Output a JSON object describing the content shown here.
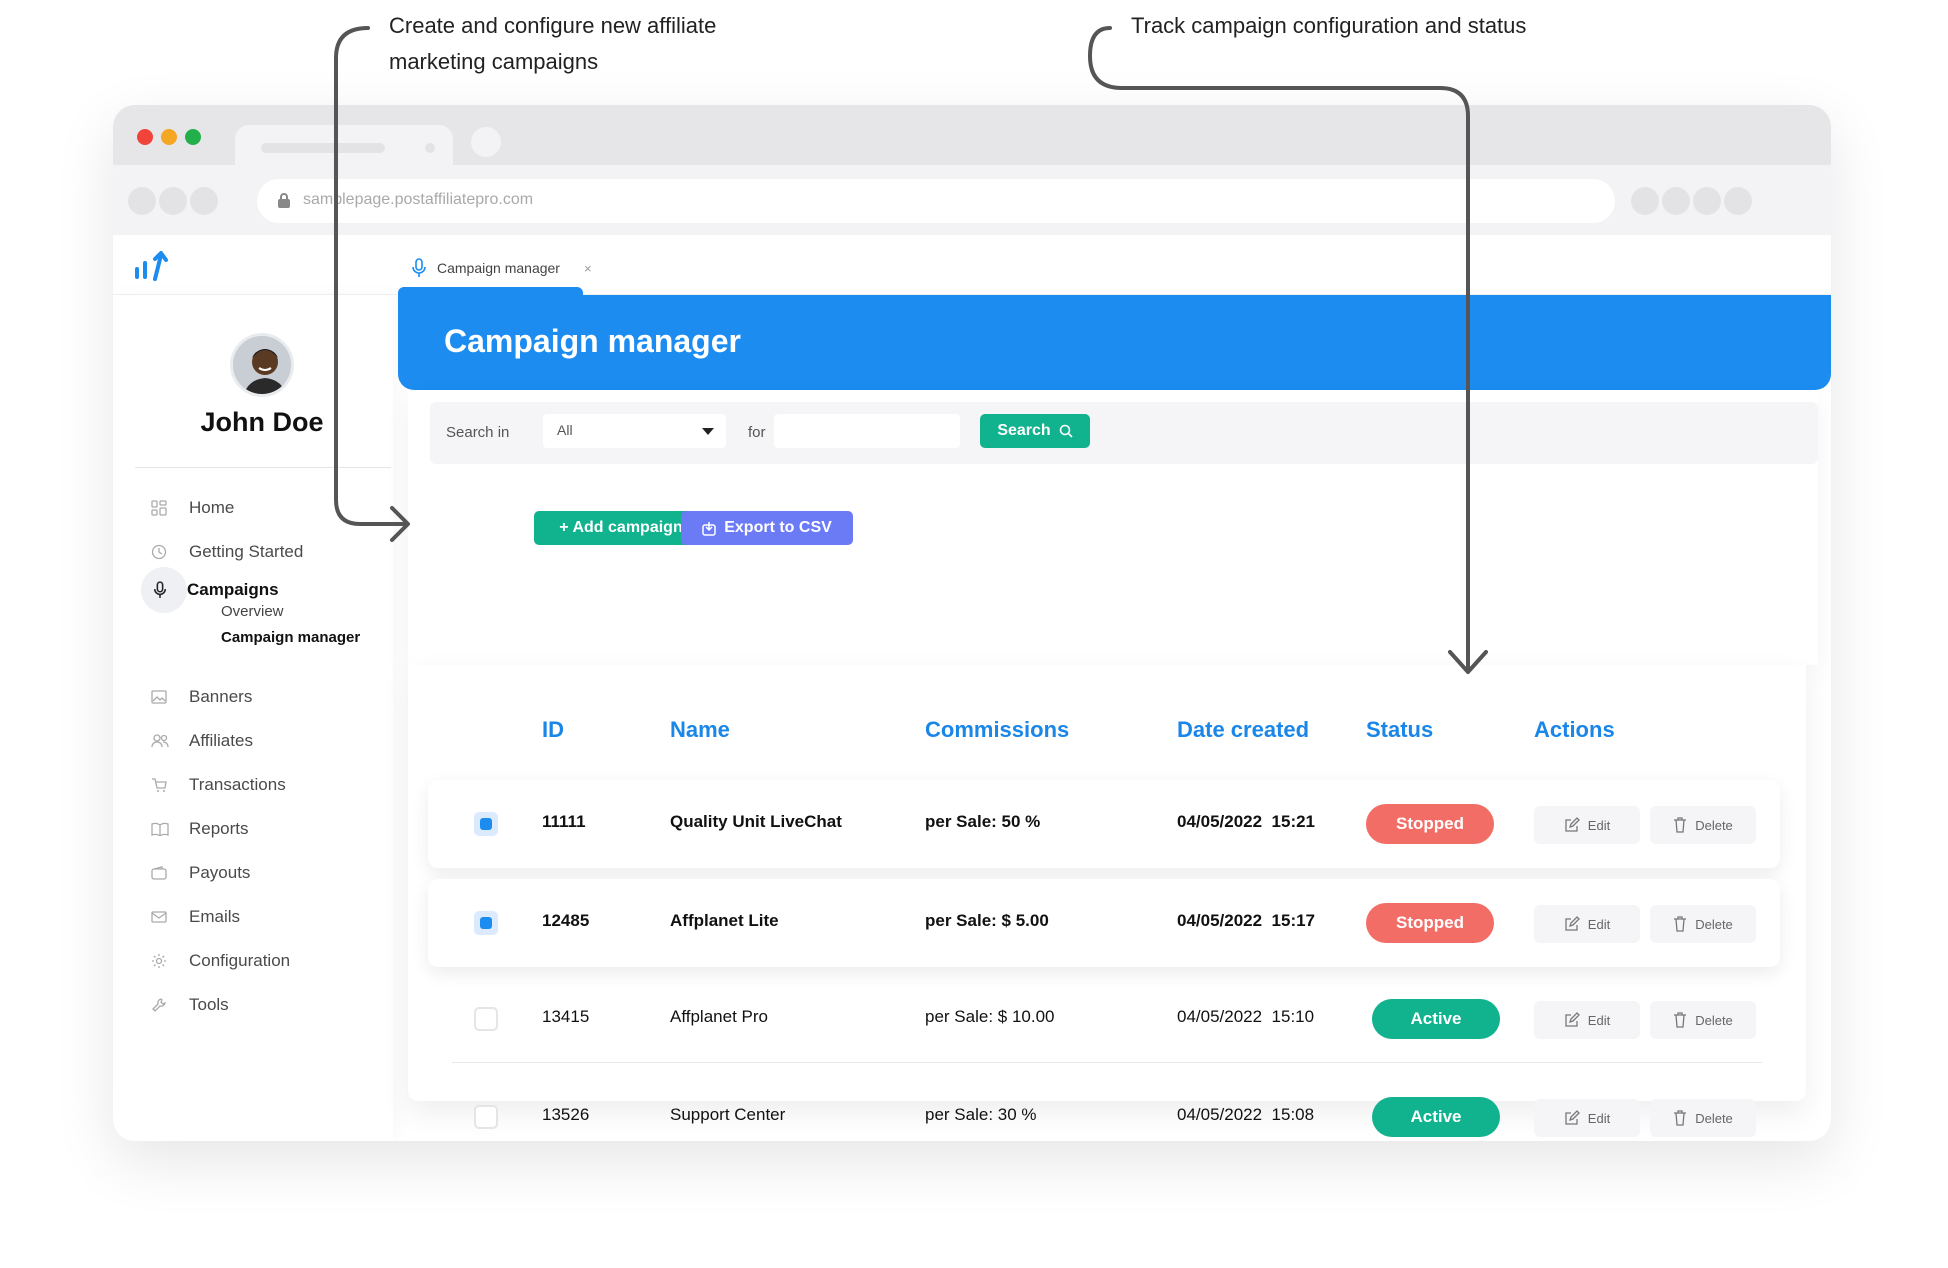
{
  "annotations": {
    "left": "Create and configure new affiliate marketing campaigns",
    "right": "Track campaign configuration and status"
  },
  "browser": {
    "url": "samplepage.postaffiliatepro.com"
  },
  "app": {
    "tab_label": "Campaign manager",
    "tab_close": "×",
    "page_title": "Campaign manager"
  },
  "user": {
    "name": "John Doe"
  },
  "sidebar": {
    "items": [
      {
        "label": "Home",
        "icon": "grid-icon"
      },
      {
        "label": "Getting Started",
        "icon": "clock-icon"
      },
      {
        "label": "Campaigns",
        "icon": "mic-icon"
      },
      {
        "label": "Banners",
        "icon": "image-icon"
      },
      {
        "label": "Affiliates",
        "icon": "users-icon"
      },
      {
        "label": "Transactions",
        "icon": "cart-icon"
      },
      {
        "label": "Reports",
        "icon": "book-icon"
      },
      {
        "label": "Payouts",
        "icon": "wallet-icon"
      },
      {
        "label": "Emails",
        "icon": "mail-icon"
      },
      {
        "label": "Configuration",
        "icon": "gear-icon"
      },
      {
        "label": "Tools",
        "icon": "wrench-icon"
      }
    ],
    "sub_items": [
      "Overview",
      "Campaign manager"
    ]
  },
  "search": {
    "search_in_label": "Search in",
    "select_value": "All",
    "for_label": "for",
    "input_value": "",
    "button_label": "Search"
  },
  "toolbar": {
    "add_label": "+ Add campaign",
    "export_label": "Export to CSV"
  },
  "table": {
    "headers": [
      "ID",
      "Name",
      "Commissions",
      "Date created",
      "Status",
      "Actions"
    ],
    "rows": [
      {
        "id": "11111",
        "name": "Quality Unit LiveChat",
        "commission": "per Sale: 50 %",
        "date": "04/05/2022  15:21",
        "status": "Stopped",
        "checked": true
      },
      {
        "id": "12485",
        "name": "Affplanet Lite",
        "commission": "per Sale: $ 5.00",
        "date": "04/05/2022  15:17",
        "status": "Stopped",
        "checked": true
      },
      {
        "id": "13415",
        "name": "Affplanet Pro",
        "commission": "per Sale: $ 10.00",
        "date": "04/05/2022  15:10",
        "status": "Active",
        "checked": false
      },
      {
        "id": "13526",
        "name": "Support Center",
        "commission": "per Sale: 30 %",
        "date": "04/05/2022  15:08",
        "status": "Active",
        "checked": false
      }
    ],
    "edit_label": "Edit",
    "delete_label": "Delete"
  },
  "colors": {
    "primary_blue": "#1c8cf0",
    "green": "#11b28e",
    "red": "#f26d66",
    "violet": "#6b7bf6"
  }
}
